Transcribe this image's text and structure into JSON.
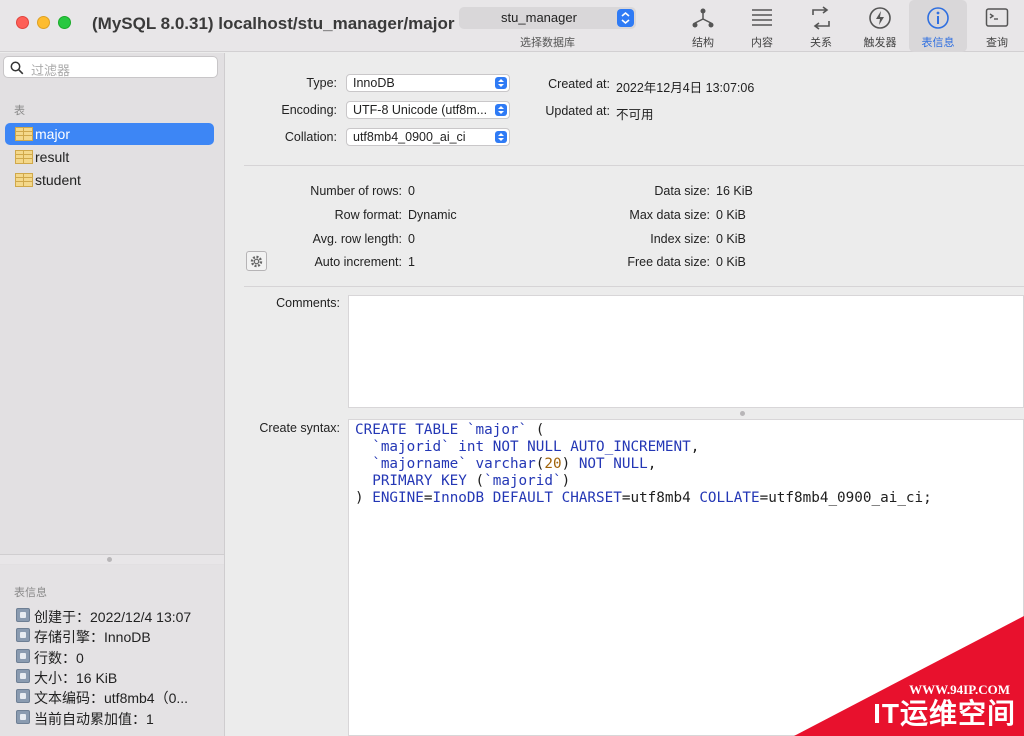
{
  "window": {
    "title": "(MySQL 8.0.31) localhost/stu_manager/major"
  },
  "toolbar": {
    "database": "stu_manager",
    "database_caption": "选择数据库",
    "items": [
      {
        "label": "结构",
        "icon": "structure-icon"
      },
      {
        "label": "内容",
        "icon": "content-icon"
      },
      {
        "label": "关系",
        "icon": "relations-icon"
      },
      {
        "label": "触发器",
        "icon": "triggers-icon"
      },
      {
        "label": "表信息",
        "icon": "table-info-icon",
        "active": true
      },
      {
        "label": "查询",
        "icon": "query-icon"
      }
    ]
  },
  "sidebar": {
    "filter_placeholder": "过滤器",
    "tables_label": "表",
    "tables": [
      "major",
      "result",
      "student"
    ],
    "selected_table": "major",
    "info_label": "表信息",
    "info": [
      "创建于：2022/12/4 13:07",
      "存储引擎：InnoDB",
      "行数：0",
      "大小：16 KiB",
      "文本编码：utf8mb4（0...",
      "当前自动累加值：1"
    ]
  },
  "main": {
    "type_label": "Type:",
    "type_value": "InnoDB",
    "encoding_label": "Encoding:",
    "encoding_value": "UTF-8 Unicode (utf8m...",
    "collation_label": "Collation:",
    "collation_value": "utf8mb4_0900_ai_ci",
    "created_label": "Created at:",
    "created_value": "2022年12月4日 13:07:06",
    "updated_label": "Updated at:",
    "updated_value": "不可用",
    "rows_label": "Number of rows:",
    "rows_value": "0",
    "row_format_label": "Row format:",
    "row_format_value": "Dynamic",
    "avg_row_label": "Avg. row length:",
    "avg_row_value": "0",
    "auto_inc_label": "Auto increment:",
    "auto_inc_value": "1",
    "data_size_label": "Data size:",
    "data_size_value": "16 KiB",
    "max_data_label": "Max data size:",
    "max_data_value": "0 KiB",
    "index_size_label": "Index size:",
    "index_size_value": "0 KiB",
    "free_data_label": "Free data size:",
    "free_data_value": "0 KiB",
    "comments_label": "Comments:",
    "create_syntax_label": "Create syntax:",
    "sql": {
      "l1_kw": "CREATE TABLE",
      "l1_id": "`major`",
      "l1_rest": " (",
      "l2_id": "`majorid`",
      "l2_kw": "int NOT NULL AUTO_INCREMENT",
      "l2_rest": ",",
      "l3_id": "`majorname`",
      "l3_kw": "varchar",
      "l3_open": "(",
      "l3_num": "20",
      "l3_close": ")",
      "l3_kw2": "NOT NULL",
      "l3_rest": ",",
      "l4_kw": "PRIMARY KEY",
      "l4_open": " (",
      "l4_id": "`majorid`",
      "l4_close": ")",
      "l5_open": ") ",
      "l5_kw1": "ENGINE",
      "l5_eq1": "=",
      "l5_kw2": "InnoDB DEFAULT CHARSET",
      "l5_eq2": "=utf8mb4 ",
      "l5_kw3": "COLLATE",
      "l5_eq3": "=utf8mb4_0900_ai_ci;"
    }
  },
  "watermark": {
    "url": "WWW.94IP.COM",
    "name": "IT运维空间"
  }
}
